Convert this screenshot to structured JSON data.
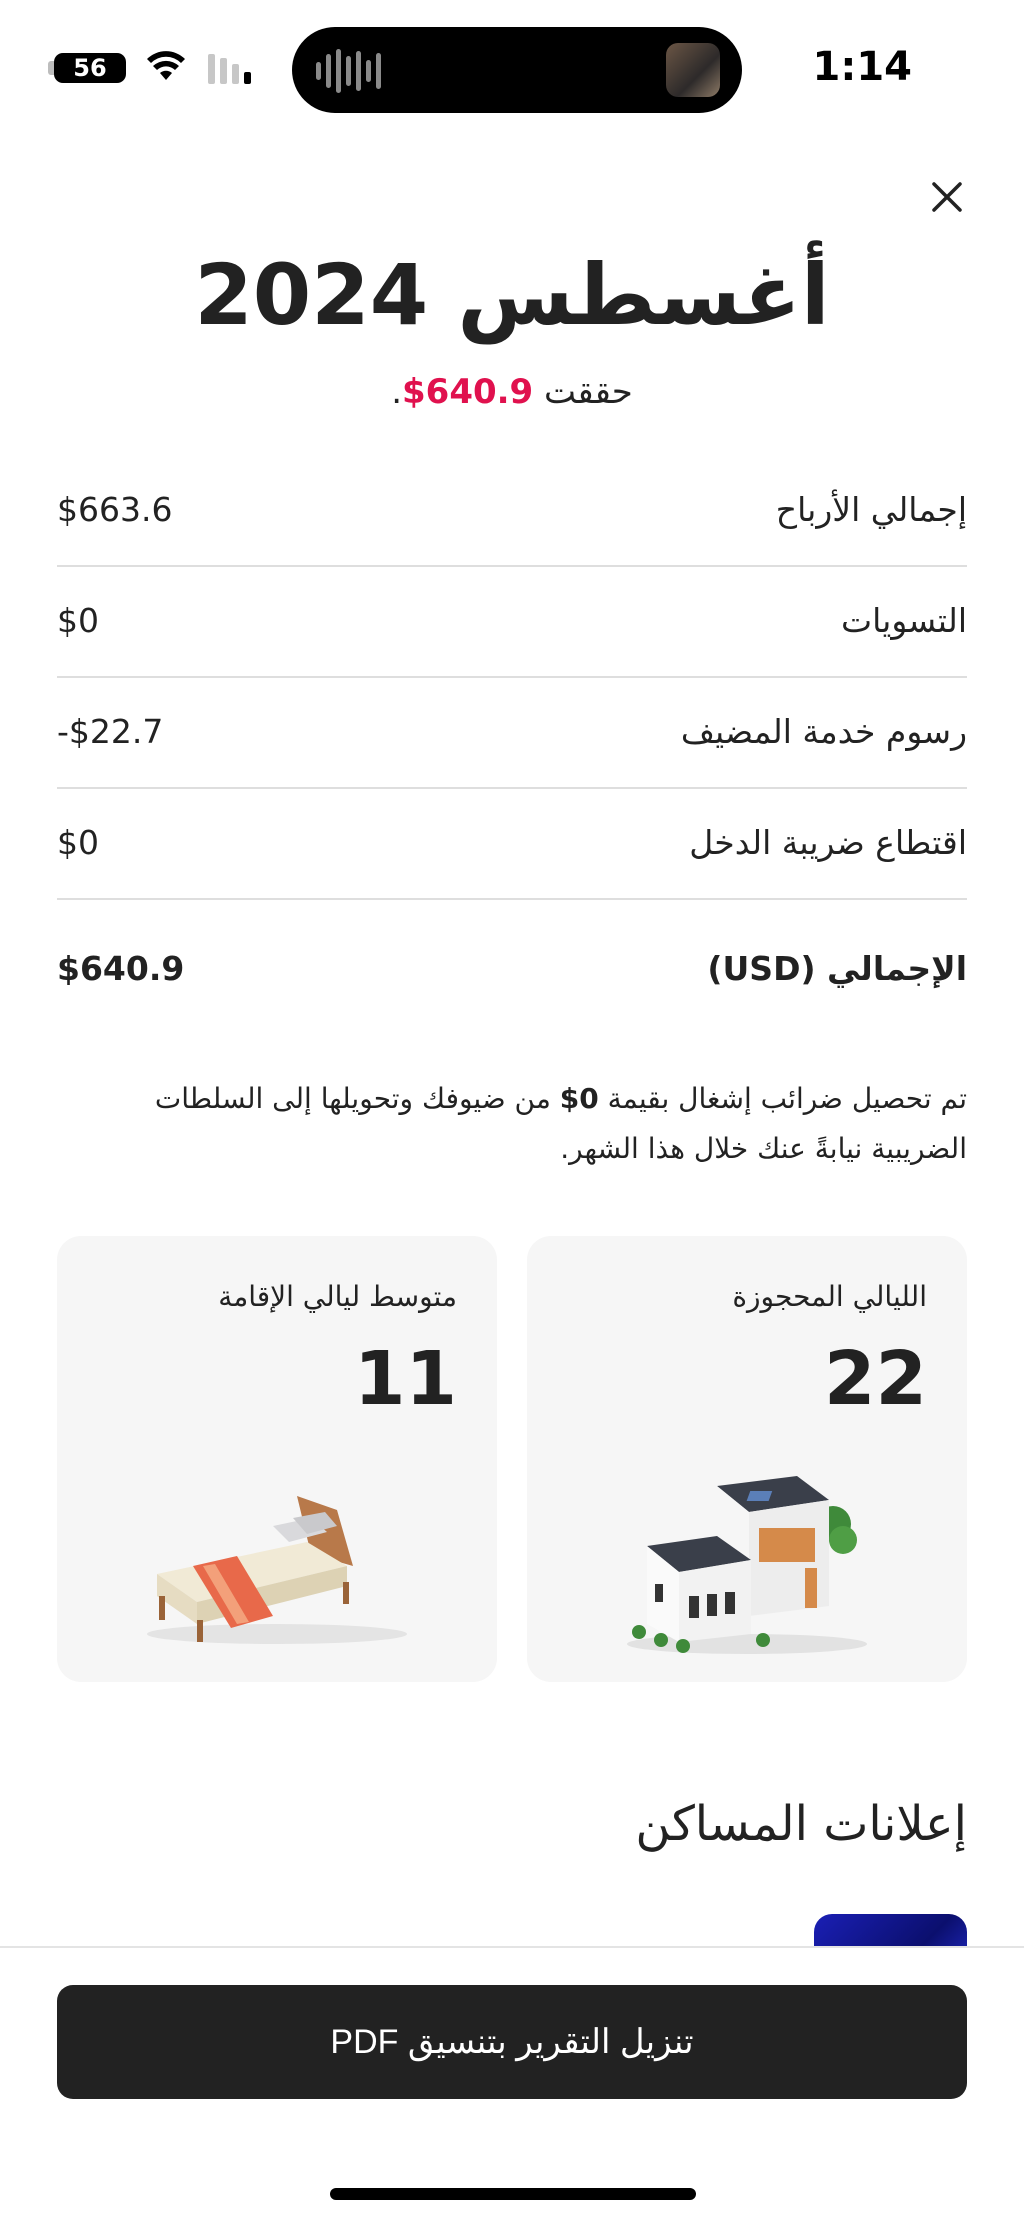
{
  "status_bar": {
    "time": "1:14",
    "battery": "56"
  },
  "report": {
    "title": "أغسطس 2024",
    "subtitle_prefix": "حققت ",
    "subtitle_amount": "$640.9",
    "subtitle_suffix": "."
  },
  "rows": [
    {
      "label": "إجمالي الأرباح",
      "value": "$663.6"
    },
    {
      "label": "التسويات",
      "value": "$0"
    },
    {
      "label": "رسوم خدمة المضيف",
      "value": "-$22.7"
    },
    {
      "label": "اقتطاع ضريبة الدخل",
      "value": "$0"
    },
    {
      "label": "الإجمالي (USD)",
      "value": "$640.9"
    }
  ],
  "note": {
    "before": "تم تحصيل ضرائب إشغال بقيمة ",
    "amount": "$0",
    "after": " من ضيوفك وتحويلها إلى السلطات الضريبية نيابةً عنك خلال هذا الشهر."
  },
  "cards": {
    "booked_nights": {
      "label": "الليالي المحجوزة",
      "value": "22"
    },
    "avg_stay": {
      "label": "متوسط ليالي الإقامة",
      "value": "11"
    }
  },
  "section": {
    "title": "إعلانات المساكن"
  },
  "download_button": {
    "label": "تنزيل التقرير بتنسيق PDF"
  },
  "icons": {
    "close": "close-icon",
    "house": "house-illustration",
    "bed": "bed-illustration"
  },
  "colors": {
    "accent": "#e0114e",
    "button_bg": "#222222",
    "card_bg": "#f6f6f6"
  }
}
